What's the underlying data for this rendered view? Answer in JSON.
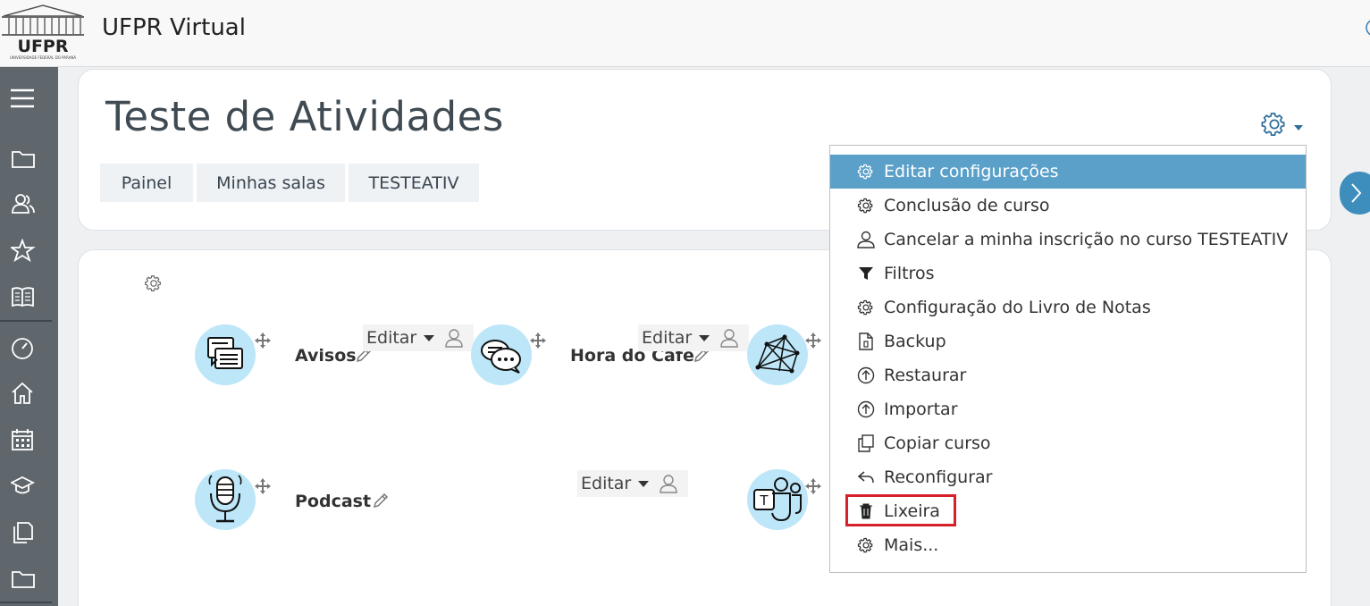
{
  "header": {
    "site_name": "UFPR Virtual",
    "logo_text": "UFPR",
    "logo_subtext": "UNIVERSIDADE FEDERAL DO PARANÁ"
  },
  "rail": {
    "items": [
      "menu-icon",
      "folder-icon",
      "users-icon",
      "star-icon",
      "book-icon",
      "dashboard-icon",
      "home-icon",
      "calendar-icon",
      "graduation-cap-icon",
      "documents-icon",
      "folder-icon"
    ]
  },
  "course": {
    "title": "Teste de Atividades",
    "breadcrumbs": [
      "Painel",
      "Minhas salas",
      "TESTEATIV"
    ]
  },
  "activities": [
    {
      "name": "Avisos",
      "icon": "forum-icon"
    },
    {
      "name": "Hora do Café",
      "icon": "chat-bubbles-icon"
    },
    {
      "name": "Podcast",
      "icon": "microphone-icon"
    }
  ],
  "edit_menu": {
    "label": "Editar"
  },
  "course_menu": {
    "items": [
      {
        "label": "Editar configurações",
        "icon": "gear-icon",
        "active": true
      },
      {
        "label": "Conclusão de curso",
        "icon": "gear-icon"
      },
      {
        "label": "Cancelar a minha inscrição no curso TESTEATIV",
        "icon": "user-icon"
      },
      {
        "label": "Filtros",
        "icon": "filter-icon"
      },
      {
        "label": "Configuração do Livro de Notas",
        "icon": "gear-icon"
      },
      {
        "label": "Backup",
        "icon": "file-icon"
      },
      {
        "label": "Restaurar",
        "icon": "upload-icon"
      },
      {
        "label": "Importar",
        "icon": "upload-icon"
      },
      {
        "label": "Copiar curso",
        "icon": "copy-icon"
      },
      {
        "label": "Reconfigurar",
        "icon": "reply-icon"
      },
      {
        "label": "Lixeira",
        "icon": "trash-icon"
      },
      {
        "label": "Mais...",
        "icon": "gear-icon"
      }
    ]
  },
  "colors": {
    "rail_bg": "#5f666c",
    "active_item": "#5aa0c9",
    "icon_bg": "#bde6f8",
    "highlight": "#d6202a"
  }
}
